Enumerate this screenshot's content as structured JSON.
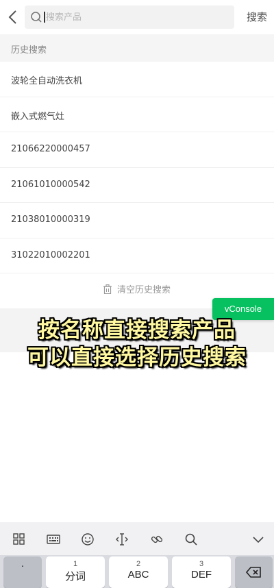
{
  "search": {
    "placeholder": "搜索产品",
    "button_label": "搜索"
  },
  "history": {
    "header": "历史搜索",
    "items": [
      "波轮全自动洗衣机",
      "嵌入式燃气灶",
      "21066220000457",
      "21061010000542",
      "21038010000319",
      "31022010002201"
    ],
    "clear_label": "清空历史搜索"
  },
  "vconsole": {
    "label": "vConsole",
    "color": "#07c160"
  },
  "caption": {
    "line1": "按名称直接搜索产品",
    "line2": "可以直接选择历史搜索"
  },
  "keyboard": {
    "toolbar_icons": [
      "grid-icon",
      "keyboard-icon",
      "emoji-icon",
      "text-cursor-icon",
      "link-icon",
      "search-icon",
      "chevron-down-icon"
    ],
    "keys": [
      {
        "num": "",
        "label": "·"
      },
      {
        "num": "1",
        "label": "分词"
      },
      {
        "num": "2",
        "label": "ABC"
      },
      {
        "num": "3",
        "label": "DEF"
      }
    ]
  }
}
